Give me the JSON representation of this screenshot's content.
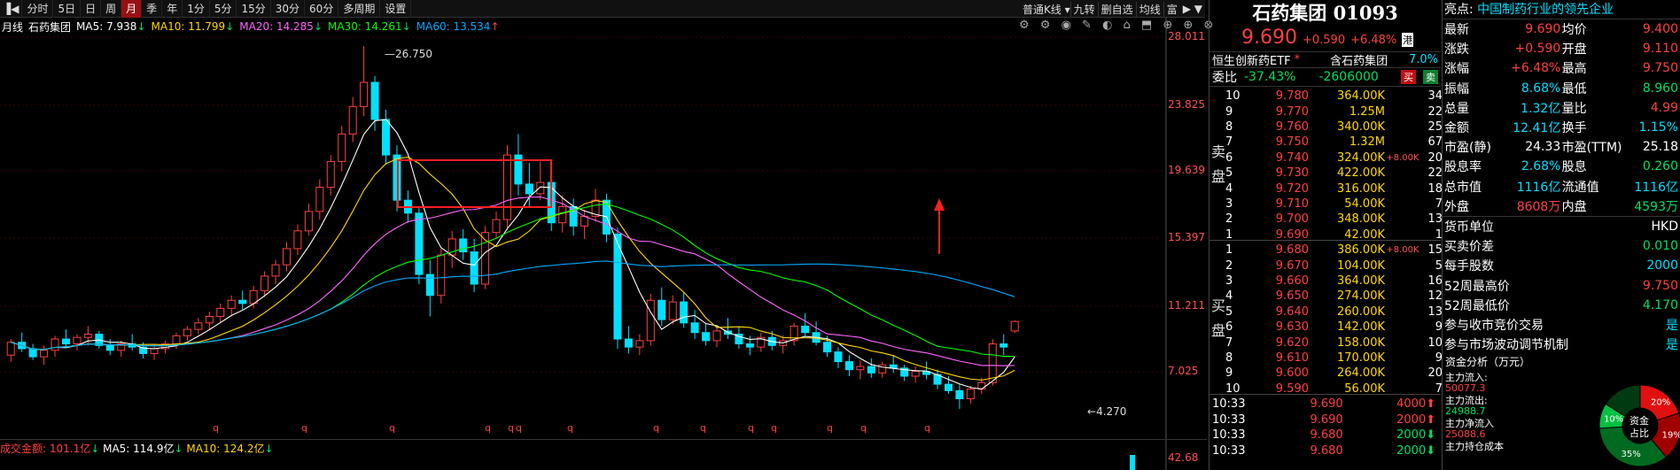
{
  "toolbar": {
    "items": [
      "分时",
      "5日",
      "日",
      "周",
      "月",
      "季",
      "年",
      "1分",
      "5分",
      "15分",
      "30分",
      "60分",
      "多周期",
      "设置"
    ],
    "active": "月",
    "chart_type": "普通K线",
    "right_tools": [
      "九转",
      "删自选",
      "均线",
      "富"
    ]
  },
  "legend": {
    "period": "月线",
    "name": "石药集团",
    "ma5": "MA5: 7.938",
    "ma10": "MA10: 11.799",
    "ma20": "MA20: 14.285",
    "ma30": "MA30: 14.261",
    "ma60": "MA60: 13.534"
  },
  "yaxis_labels": [
    "28.011",
    "23.825",
    "19.639",
    "15.397",
    "11.211",
    "7.025"
  ],
  "annotations": {
    "high": "26.750",
    "low": "4.270"
  },
  "volume": {
    "label": "成交金额: 101.1亿",
    "ma5": "MA5: 114.9亿",
    "ma10": "MA10: 124.2亿",
    "axis": "42.68"
  },
  "colors": {
    "up": "#ff4040",
    "down": "#00e0ff",
    "ma5": "#ffffff",
    "ma10": "#ffd700",
    "ma20": "#ff66ff",
    "ma30": "#00ff00",
    "ma60": "#00aaff",
    "box": "#ff2020"
  },
  "quote": {
    "title": "石药集团 01093",
    "price": "9.690",
    "change": "+0.590",
    "pct": "+6.48%",
    "tag": "港",
    "etf": "恒生创新药ETF",
    "etf_label": "含石药集团",
    "etf_pct": "7.0%",
    "wb_label": "委比",
    "wb": "-37.43%",
    "wc": "-2606000",
    "sell_label": "卖盘",
    "buy_label": "买盘",
    "btn_buy": "买",
    "btn_sell": "卖",
    "asks": [
      {
        "lv": "10",
        "p": "9.780",
        "v": "364.00K",
        "n": "",
        "c": "34"
      },
      {
        "lv": "9",
        "p": "9.770",
        "v": "1.25M",
        "n": "",
        "c": "22"
      },
      {
        "lv": "8",
        "p": "9.760",
        "v": "340.00K",
        "n": "",
        "c": "25"
      },
      {
        "lv": "7",
        "p": "9.750",
        "v": "1.32M",
        "n": "",
        "c": "67"
      },
      {
        "lv": "6",
        "p": "9.740",
        "v": "324.00K",
        "n": "+8.00K",
        "c": "20"
      },
      {
        "lv": "5",
        "p": "9.730",
        "v": "422.00K",
        "n": "",
        "c": "22"
      },
      {
        "lv": "4",
        "p": "9.720",
        "v": "316.00K",
        "n": "",
        "c": "18"
      },
      {
        "lv": "3",
        "p": "9.710",
        "v": "54.00K",
        "n": "",
        "c": "7"
      },
      {
        "lv": "2",
        "p": "9.700",
        "v": "348.00K",
        "n": "",
        "c": "13"
      },
      {
        "lv": "1",
        "p": "9.690",
        "v": "42.00K",
        "n": "",
        "c": "1"
      }
    ],
    "bids": [
      {
        "lv": "1",
        "p": "9.680",
        "v": "386.00K",
        "n": "+8.00K",
        "c": "15"
      },
      {
        "lv": "2",
        "p": "9.670",
        "v": "104.00K",
        "n": "",
        "c": "5"
      },
      {
        "lv": "3",
        "p": "9.660",
        "v": "364.00K",
        "n": "",
        "c": "16"
      },
      {
        "lv": "4",
        "p": "9.650",
        "v": "274.00K",
        "n": "",
        "c": "12"
      },
      {
        "lv": "5",
        "p": "9.640",
        "v": "260.00K",
        "n": "",
        "c": "13"
      },
      {
        "lv": "6",
        "p": "9.630",
        "v": "142.00K",
        "n": "",
        "c": "9"
      },
      {
        "lv": "7",
        "p": "9.620",
        "v": "158.00K",
        "n": "",
        "c": "10"
      },
      {
        "lv": "8",
        "p": "9.610",
        "v": "170.00K",
        "n": "",
        "c": "9"
      },
      {
        "lv": "9",
        "p": "9.600",
        "v": "264.00K",
        "n": "",
        "c": "20"
      },
      {
        "lv": "10",
        "p": "9.590",
        "v": "56.00K",
        "n": "",
        "c": "7"
      }
    ],
    "ticks": [
      {
        "t": "10:33",
        "p": "9.690",
        "v": "4000",
        "d": "up"
      },
      {
        "t": "10:33",
        "p": "9.690",
        "v": "2000",
        "d": "up"
      },
      {
        "t": "10:33",
        "p": "9.680",
        "v": "2000",
        "d": "dn"
      },
      {
        "t": "10:33",
        "p": "9.680",
        "v": "2000",
        "d": "dn"
      }
    ]
  },
  "info": {
    "highlight_label": "亮点:",
    "highlight": "中国制药行业的领先企业",
    "rows": [
      {
        "a": "最新",
        "av": "9.690",
        "ac": "up",
        "b": "均价",
        "bv": "9.400",
        "bc": "up"
      },
      {
        "a": "涨跌",
        "av": "+0.590",
        "ac": "up",
        "b": "开盘",
        "bv": "9.110",
        "bc": "up"
      },
      {
        "a": "涨幅",
        "av": "+6.48%",
        "ac": "up",
        "b": "最高",
        "bv": "9.750",
        "bc": "up"
      },
      {
        "a": "振幅",
        "av": "8.68%",
        "ac": "cy",
        "b": "最低",
        "bv": "8.960",
        "bc": "dn"
      },
      {
        "a": "总量",
        "av": "1.32亿",
        "ac": "cy",
        "b": "量比",
        "bv": "4.99",
        "bc": "up"
      },
      {
        "a": "金额",
        "av": "12.41亿",
        "ac": "cy",
        "b": "换手",
        "bv": "1.15%",
        "bc": "cy"
      },
      {
        "a": "市盈(静)",
        "av": "24.33",
        "ac": "wh",
        "b": "市盈(TTM)",
        "bv": "25.18",
        "bc": "wh"
      },
      {
        "a": "股息率",
        "av": "2.68%",
        "ac": "cy",
        "b": "股息",
        "bv": "0.260",
        "bc": "dn"
      },
      {
        "a": "总市值",
        "av": "1116亿",
        "ac": "cy",
        "b": "流通值",
        "bv": "1116亿",
        "bc": "cy"
      },
      {
        "a": "外盘",
        "av": "8608万",
        "ac": "up",
        "b": "内盘",
        "bv": "4593万",
        "bc": "dn"
      }
    ],
    "rows2": [
      {
        "k": "货币单位",
        "v": "HKD",
        "c": "wh"
      },
      {
        "k": "买卖价差",
        "v": "0.010",
        "c": "dn"
      },
      {
        "k": "每手股数",
        "v": "2000",
        "c": "cy"
      },
      {
        "k": "52周最高价",
        "v": "9.750",
        "c": "up"
      },
      {
        "k": "52周最低价",
        "v": "4.170",
        "c": "dn"
      },
      {
        "k": "参与收市竞价交易",
        "v": "是",
        "c": "cy"
      },
      {
        "k": "参与市场波动调节机制",
        "v": "是",
        "c": "cy"
      }
    ],
    "fund_title": "资金分析（万元）",
    "fund": [
      {
        "k": "主力流入:",
        "v": "50077.3",
        "c": "up"
      },
      {
        "k": "主力流出:",
        "v": "24988.7",
        "c": "dn"
      },
      {
        "k": "主力净流入",
        "v": "25088.6",
        "c": "up"
      },
      {
        "k": "主力持仓成本",
        "v": "",
        "c": "wh"
      }
    ],
    "donut_center": "资金占比",
    "donut": [
      {
        "label": "20%",
        "value": 20,
        "color": "#e01010"
      },
      {
        "label": "19%",
        "value": 19,
        "color": "#a00000"
      },
      {
        "label": "35%",
        "value": 35,
        "color": "#006a20"
      },
      {
        "label": "10%",
        "value": 10,
        "color": "#00c040"
      },
      {
        "label": "",
        "value": 16,
        "color": "#003a10"
      }
    ]
  },
  "chart_data": {
    "type": "candlestick",
    "note_ma": [
      "MA5",
      "MA10",
      "MA20",
      "MA30",
      "MA60"
    ],
    "ylim": [
      4.27,
      28.011
    ],
    "candles": [
      [
        7.6,
        8.6,
        7.2,
        8.4
      ],
      [
        8.4,
        9.0,
        7.8,
        8.0
      ],
      [
        8.0,
        8.3,
        7.3,
        7.5
      ],
      [
        7.5,
        8.2,
        7.0,
        7.9
      ],
      [
        7.9,
        8.8,
        7.5,
        8.6
      ],
      [
        8.6,
        9.2,
        8.1,
        8.3
      ],
      [
        8.3,
        8.9,
        7.9,
        8.7
      ],
      [
        8.7,
        9.4,
        8.2,
        8.9
      ],
      [
        8.9,
        9.1,
        8.0,
        8.2
      ],
      [
        8.2,
        8.6,
        7.6,
        7.9
      ],
      [
        7.9,
        8.5,
        7.5,
        8.3
      ],
      [
        8.3,
        8.9,
        7.9,
        8.1
      ],
      [
        8.1,
        8.4,
        7.4,
        7.7
      ],
      [
        7.7,
        8.2,
        7.3,
        8.0
      ],
      [
        8.0,
        8.5,
        7.7,
        8.3
      ],
      [
        8.3,
        9.0,
        8.0,
        8.8
      ],
      [
        8.8,
        9.4,
        8.5,
        9.2
      ],
      [
        9.2,
        9.9,
        8.9,
        9.6
      ],
      [
        9.6,
        10.3,
        9.2,
        10.0
      ],
      [
        10.0,
        10.8,
        9.6,
        10.5
      ],
      [
        10.5,
        11.3,
        10.0,
        11.0
      ],
      [
        11.0,
        11.6,
        10.4,
        10.8
      ],
      [
        10.8,
        11.9,
        10.5,
        11.6
      ],
      [
        11.6,
        12.8,
        11.2,
        12.5
      ],
      [
        12.5,
        13.5,
        12.0,
        13.2
      ],
      [
        13.2,
        14.6,
        12.8,
        14.2
      ],
      [
        14.2,
        15.7,
        13.8,
        15.3
      ],
      [
        15.3,
        17.0,
        15.0,
        16.5
      ],
      [
        16.5,
        18.5,
        16.0,
        18.0
      ],
      [
        18.0,
        20.0,
        17.5,
        19.6
      ],
      [
        19.6,
        21.8,
        19.0,
        21.3
      ],
      [
        21.3,
        23.6,
        20.8,
        23.0
      ],
      [
        23.0,
        26.75,
        22.4,
        24.5
      ],
      [
        24.5,
        24.9,
        21.5,
        22.2
      ],
      [
        22.2,
        22.8,
        19.4,
        20.0
      ],
      [
        20.0,
        20.6,
        16.5,
        17.2
      ],
      [
        17.2,
        17.8,
        15.8,
        16.4
      ],
      [
        16.4,
        16.8,
        12.0,
        12.6
      ],
      [
        12.6,
        13.5,
        10.0,
        11.3
      ],
      [
        11.3,
        14.2,
        10.8,
        13.8
      ],
      [
        13.8,
        15.3,
        13.0,
        14.8
      ],
      [
        14.8,
        15.4,
        13.5,
        14.0
      ],
      [
        14.0,
        14.8,
        11.5,
        12.0
      ],
      [
        12.0,
        15.6,
        11.7,
        15.2
      ],
      [
        15.2,
        16.5,
        14.8,
        16.0
      ],
      [
        16.0,
        20.6,
        15.5,
        20.0
      ],
      [
        20.0,
        21.3,
        17.5,
        18.2
      ],
      [
        18.2,
        19.5,
        16.8,
        17.6
      ],
      [
        17.6,
        19.6,
        17.2,
        18.3
      ],
      [
        18.3,
        18.8,
        15.3,
        15.8
      ],
      [
        15.8,
        17.5,
        15.2,
        16.8
      ],
      [
        16.8,
        17.3,
        15.0,
        15.6
      ],
      [
        15.6,
        16.6,
        14.8,
        16.2
      ],
      [
        16.2,
        17.9,
        15.9,
        17.2
      ],
      [
        17.2,
        17.6,
        14.6,
        15.1
      ],
      [
        15.1,
        15.5,
        8.0,
        8.6
      ],
      [
        8.6,
        9.4,
        7.7,
        8.1
      ],
      [
        8.1,
        8.9,
        7.6,
        8.5
      ],
      [
        8.5,
        11.4,
        8.2,
        11.0
      ],
      [
        11.0,
        11.8,
        9.4,
        9.8
      ],
      [
        9.8,
        11.3,
        9.5,
        10.9
      ],
      [
        10.9,
        11.5,
        9.3,
        9.6
      ],
      [
        9.6,
        10.4,
        8.6,
        9.0
      ],
      [
        9.0,
        9.6,
        8.2,
        8.5
      ],
      [
        8.5,
        9.4,
        8.1,
        9.1
      ],
      [
        9.1,
        9.9,
        8.6,
        8.9
      ],
      [
        8.9,
        9.4,
        8.0,
        8.3
      ],
      [
        8.3,
        8.8,
        7.6,
        8.1
      ],
      [
        8.1,
        9.0,
        7.8,
        8.7
      ],
      [
        8.7,
        9.1,
        7.9,
        8.2
      ],
      [
        8.2,
        8.8,
        7.7,
        8.5
      ],
      [
        8.5,
        9.6,
        8.2,
        9.4
      ],
      [
        9.4,
        10.2,
        8.8,
        9.0
      ],
      [
        9.0,
        9.7,
        8.2,
        8.4
      ],
      [
        8.4,
        8.8,
        7.5,
        7.8
      ],
      [
        7.8,
        8.1,
        6.8,
        7.2
      ],
      [
        7.2,
        7.6,
        6.3,
        6.7
      ],
      [
        6.7,
        7.3,
        6.1,
        6.9
      ],
      [
        6.9,
        7.4,
        6.2,
        6.5
      ],
      [
        6.5,
        7.2,
        6.2,
        7.0
      ],
      [
        7.0,
        7.6,
        6.5,
        6.8
      ],
      [
        6.8,
        7.0,
        6.0,
        6.3
      ],
      [
        6.3,
        6.9,
        5.9,
        6.6
      ],
      [
        6.6,
        7.2,
        6.1,
        6.4
      ],
      [
        6.4,
        6.7,
        5.5,
        5.8
      ],
      [
        5.8,
        6.3,
        5.2,
        5.4
      ],
      [
        5.4,
        5.8,
        4.27,
        4.9
      ],
      [
        4.9,
        5.7,
        4.6,
        5.5
      ],
      [
        5.5,
        6.2,
        5.2,
        5.9
      ],
      [
        5.9,
        8.6,
        5.7,
        8.3
      ],
      [
        8.3,
        8.9,
        7.6,
        8.1
      ],
      [
        9.1,
        9.75,
        8.96,
        9.69
      ]
    ]
  }
}
